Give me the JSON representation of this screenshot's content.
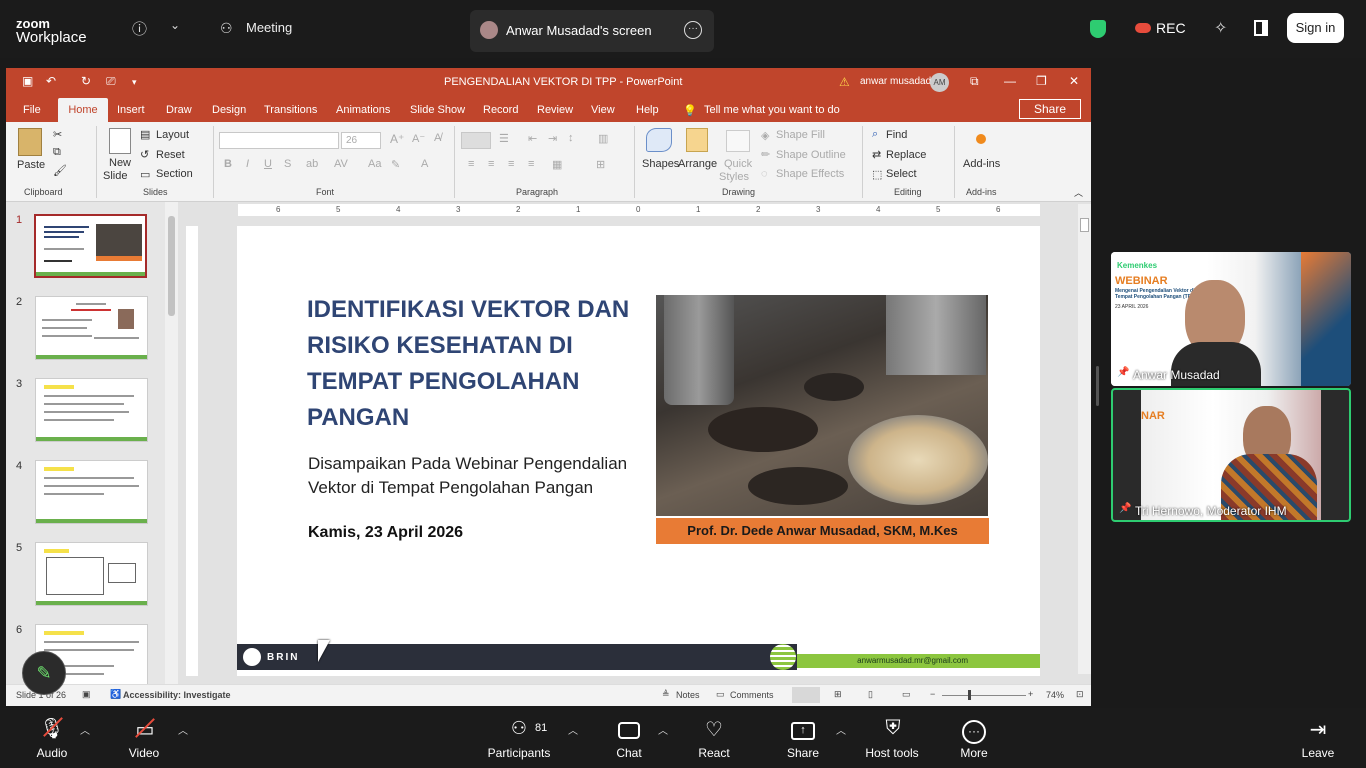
{
  "zoom": {
    "logo_line1": "zoom",
    "logo_line2": "Workplace",
    "info_icon": "info-icon",
    "meeting_label": "Meeting",
    "screen_tab": "Anwar Musadad's screen",
    "rec": "REC",
    "sign_in": "Sign in"
  },
  "ppt": {
    "title": "PENGENDALIAN VEKTOR DI TPP  -  PowerPoint",
    "user": "anwar musadad",
    "user_initials": "AM",
    "tabs": [
      "File",
      "Home",
      "Insert",
      "Draw",
      "Design",
      "Transitions",
      "Animations",
      "Slide Show",
      "Record",
      "Review",
      "View",
      "Help"
    ],
    "tell_me": "Tell me what you want to do",
    "share": "Share",
    "ribbon": {
      "paste": "Paste",
      "clipboard": "Clipboard",
      "new_slide_1": "New",
      "new_slide_2": "Slide",
      "layout": "Layout",
      "reset": "Reset",
      "section": "Section",
      "slides": "Slides",
      "font_size": "26",
      "font": "Font",
      "paragraph": "Paragraph",
      "shapes": "Shapes",
      "arrange": "Arrange",
      "quick_styles_1": "Quick",
      "quick_styles_2": "Styles",
      "shape_fill": "Shape Fill",
      "shape_outline": "Shape Outline",
      "shape_effects": "Shape Effects",
      "drawing": "Drawing",
      "find": "Find",
      "replace": "Replace",
      "select": "Select",
      "editing": "Editing",
      "addins": "Add-ins",
      "addins_group": "Add-ins"
    },
    "thumb_numbers": [
      "1",
      "2",
      "3",
      "4",
      "5",
      "6"
    ],
    "slide": {
      "title": "IDENTIFIKASI VEKTOR DAN RISIKO KESEHATAN  DI TEMPAT PENGOLAHAN PANGAN",
      "subtitle": "Disampaikan Pada Webinar Pengendalian Vektor di Tempat Pengolahan Pangan",
      "date": "Kamis,  23 April  2026",
      "presenter": "Prof. Dr. Dede Anwar Musadad, SKM, M.Kes",
      "brain": "BRIN",
      "email": "anwarmusadad.mr@gmail.com"
    },
    "ruler": [
      "6",
      "5",
      "4",
      "3",
      "2",
      "1",
      "0",
      "1",
      "2",
      "3",
      "4",
      "5",
      "6"
    ],
    "status": {
      "slide_of": "Slide 1 of 26",
      "accessibility": "Accessibility: Investigate",
      "notes": "Notes",
      "comments": "Comments",
      "zoom": "74%"
    }
  },
  "videos": {
    "p1_name": "Anwar Musadad",
    "p2_name": "Tri  Hernowo, Moderator IHM",
    "webinar": "WEBINAR",
    "kemenkes": "Kemenkes",
    "webinar_sub": "Mengenai Pengendalian Vektor di Tempat Pengolahan Pangan (TPP)",
    "webinar_date": "23 APRIL 2026"
  },
  "toolbar": {
    "audio": "Audio",
    "video": "Video",
    "participants": "Participants",
    "participants_count": "81",
    "chat": "Chat",
    "react": "React",
    "share": "Share",
    "host_tools": "Host tools",
    "more": "More",
    "leave": "Leave"
  }
}
